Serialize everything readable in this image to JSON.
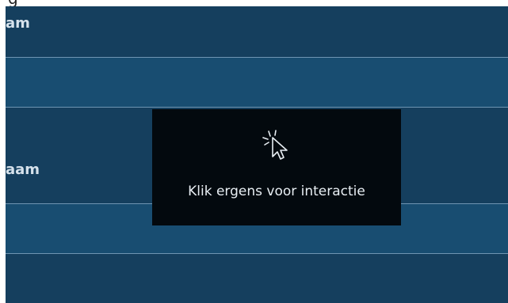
{
  "rows": [
    {
      "label": "am"
    },
    {
      "label": ""
    },
    {
      "label": "aam"
    },
    {
      "label": ""
    },
    {
      "label": ""
    }
  ],
  "overlay": {
    "message": "Klik ergens voor interactie",
    "icon": "click-cursor-icon"
  },
  "colors": {
    "row_dark": "#153f5e",
    "row_light": "#184d71",
    "divider": "#6f95b2",
    "overlay_bg": "#03090e",
    "label_text": "#d6e2ec"
  }
}
